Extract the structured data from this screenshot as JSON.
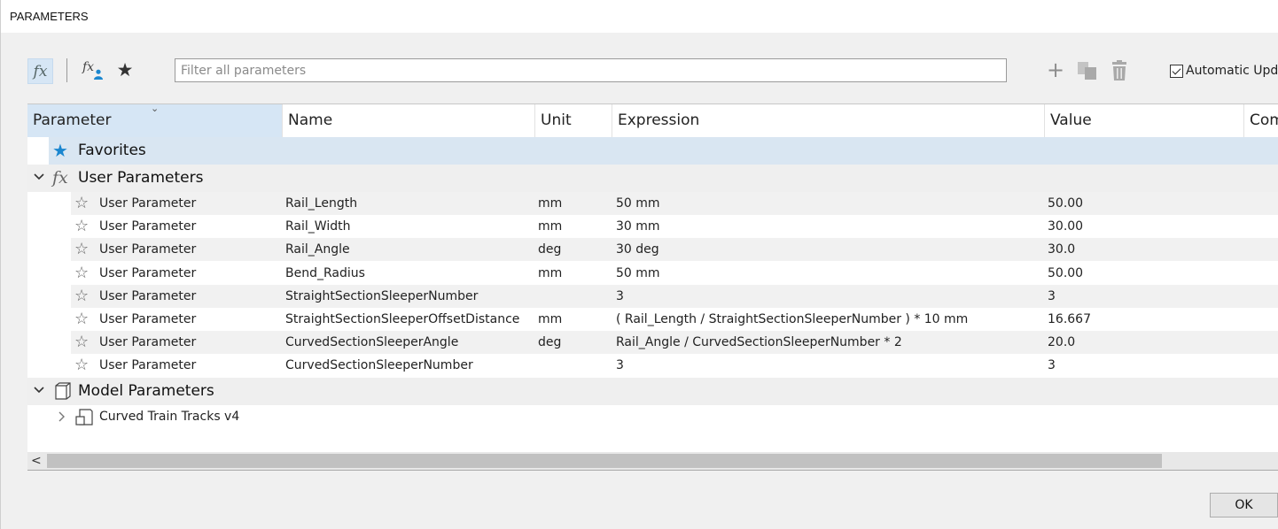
{
  "window": {
    "title": "PARAMETERS"
  },
  "toolbar": {
    "fx_icon": "fx-icon",
    "user_fx_icon": "fx-user-icon",
    "favorites_icon": "star-icon",
    "filter_placeholder": "Filter all parameters",
    "add_icon": "plus-icon",
    "copy_icon": "copy-icon",
    "delete_icon": "trash-icon",
    "auto_update_label": "Automatic Upd",
    "auto_update_checked": true
  },
  "table": {
    "columns": [
      "Parameter",
      "Name",
      "Unit",
      "Expression",
      "Value",
      "Com"
    ],
    "favorites_label": "Favorites",
    "user_group_label": "User Parameters",
    "model_group_label": "Model Parameters",
    "rows": [
      {
        "parameter": "User Parameter",
        "name": "Rail_Length",
        "unit": "mm",
        "expression": "50 mm",
        "value": "50.00"
      },
      {
        "parameter": "User Parameter",
        "name": "Rail_Width",
        "unit": "mm",
        "expression": "30 mm",
        "value": "30.00"
      },
      {
        "parameter": "User Parameter",
        "name": "Rail_Angle",
        "unit": "deg",
        "expression": "30 deg",
        "value": "30.0"
      },
      {
        "parameter": "User Parameter",
        "name": "Bend_Radius",
        "unit": "mm",
        "expression": "50 mm",
        "value": "50.00"
      },
      {
        "parameter": "User Parameter",
        "name": "StraightSectionSleeperNumber",
        "unit": "",
        "expression": "3",
        "value": "3"
      },
      {
        "parameter": "User Parameter",
        "name": "StraightSectionSleeperOffsetDistance",
        "unit": "mm",
        "expression": "( Rail_Length / StraightSectionSleeperNumber ) * 10 mm",
        "value": "16.667"
      },
      {
        "parameter": "User Parameter",
        "name": "CurvedSectionSleeperAngle",
        "unit": "deg",
        "expression": "Rail_Angle / CurvedSectionSleeperNumber * 2",
        "value": "20.0"
      },
      {
        "parameter": "User Parameter",
        "name": "CurvedSectionSleeperNumber",
        "unit": "",
        "expression": "3",
        "value": "3"
      }
    ],
    "model_item": "Curved Train Tracks v4"
  },
  "footer": {
    "ok_label": "OK"
  },
  "colors": {
    "accent": "#1a86cf",
    "header_sorted": "#d6e6f5",
    "favorites_row": "#d9e6f2"
  }
}
